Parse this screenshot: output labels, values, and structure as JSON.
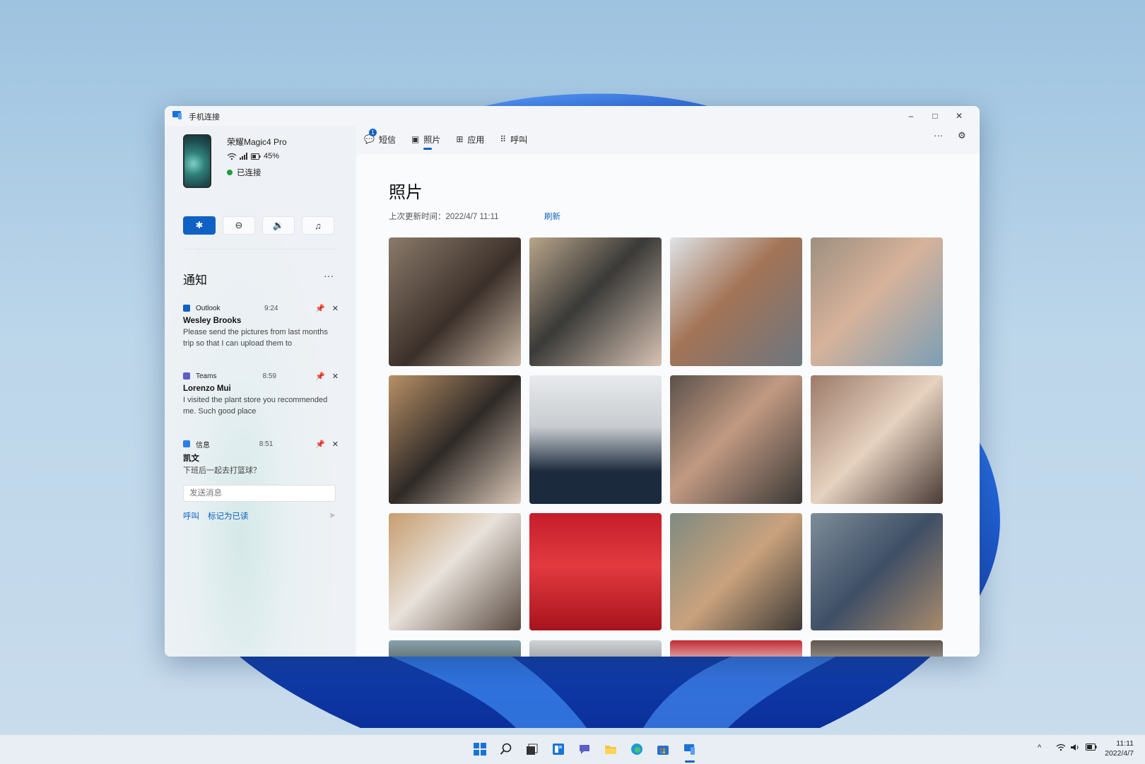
{
  "window": {
    "title": "手机连接",
    "controls": {
      "minimize": "–",
      "maximize": "□",
      "close": "✕"
    }
  },
  "device": {
    "name": "荣耀Magic4 Pro",
    "battery": "45%",
    "connection": "已连接"
  },
  "quick_actions": [
    {
      "icon": "bluetooth-icon",
      "glyph": "✱",
      "active": true
    },
    {
      "icon": "do-not-disturb-icon",
      "glyph": "⊖",
      "active": false
    },
    {
      "icon": "volume-icon",
      "glyph": "🔉",
      "active": false
    },
    {
      "icon": "music-icon",
      "glyph": "♫",
      "active": false
    }
  ],
  "notifications": {
    "title": "通知",
    "more": "···",
    "items": [
      {
        "app": "Outlook",
        "time": "9:24",
        "sender": "Wesley Brooks",
        "body": "Please send the pictures from last months trip so that I can upload them to",
        "color": "#0f62c4"
      },
      {
        "app": "Teams",
        "time": "8:59",
        "sender": "Lorenzo Mui",
        "body": "I visited the plant store you recommended me. Such good place",
        "color": "#5b5fc7"
      },
      {
        "app": "信息",
        "time": "8:51",
        "sender": "凯文",
        "body": "下班后一起去打篮球？",
        "color": "#2b7de9"
      }
    ],
    "reply_placeholder": "发送消息",
    "reply_actions": {
      "call": "呼叫",
      "mark_read": "标记为已读"
    }
  },
  "tabs": [
    {
      "label": "短信",
      "icon": "message-icon",
      "glyph": "💬",
      "badge": "1"
    },
    {
      "label": "照片",
      "icon": "photo-icon",
      "glyph": "▣",
      "active": true
    },
    {
      "label": "应用",
      "icon": "apps-icon",
      "glyph": "⊞"
    },
    {
      "label": "呼叫",
      "icon": "dialpad-icon",
      "glyph": "⠿"
    }
  ],
  "toolbar": {
    "more": "···",
    "settings": "⚙"
  },
  "photos_page": {
    "title": "照片",
    "updated": "上次更新时间：2022/4/7 11:11",
    "refresh": "刷新"
  },
  "taskbar": {
    "time": "11:11",
    "date": "2022/4/7",
    "tray_up": "^"
  },
  "colors": {
    "accent": "#0f62c4",
    "connected": "#1e9e3a"
  }
}
